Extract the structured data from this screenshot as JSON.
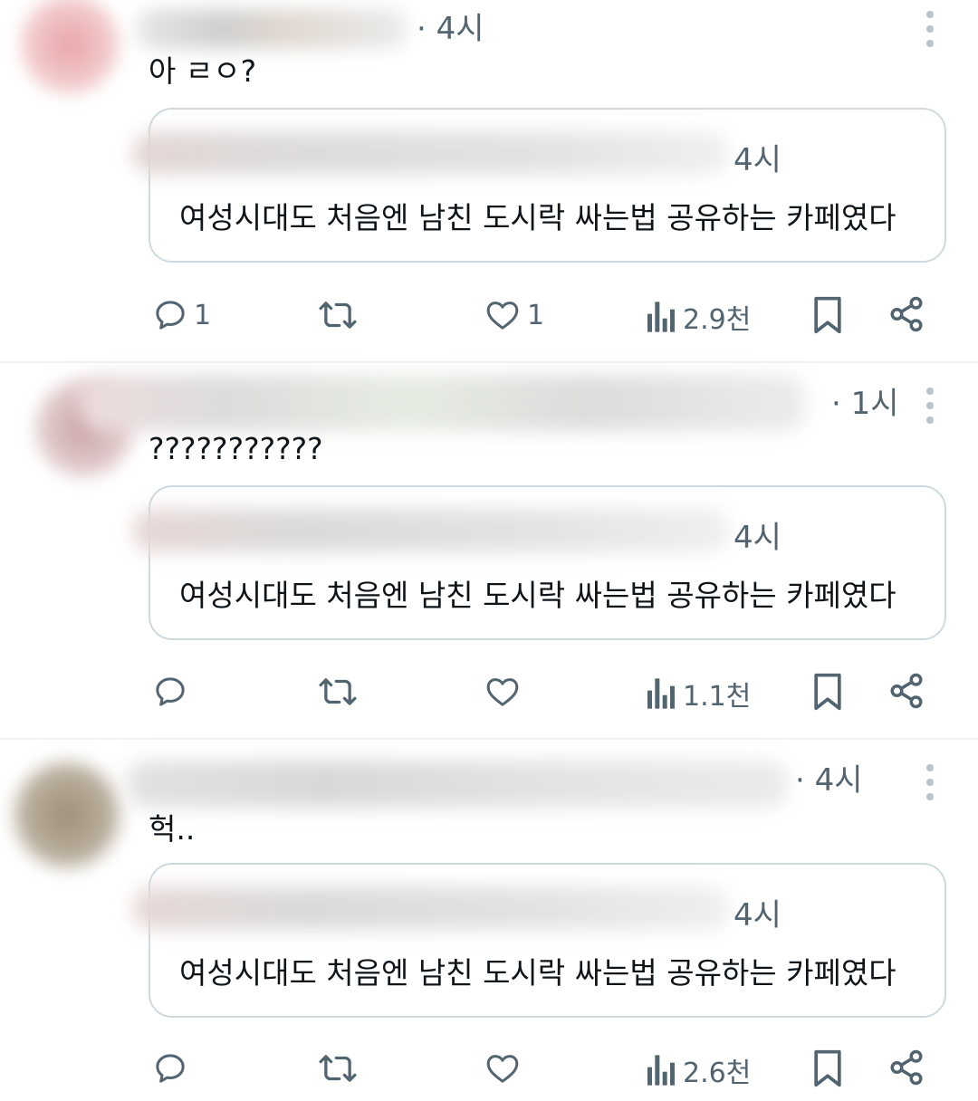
{
  "posts": [
    {
      "time": "· 4시",
      "text": "아 ㄹㅇ?",
      "quote": {
        "time": "4시",
        "text": "여성시대도 처음엔 남친 도시락 싸는법 공유하는 카페였다"
      },
      "actions": {
        "replies": "1",
        "retweets": "",
        "likes": "1",
        "views": "2.9천"
      }
    },
    {
      "time": "· 1시",
      "text": "???????????",
      "quote": {
        "time": "4시",
        "text": "여성시대도 처음엔 남친 도시락 싸는법 공유하는 카페였다"
      },
      "actions": {
        "replies": "",
        "retweets": "",
        "likes": "",
        "views": "1.1천"
      }
    },
    {
      "time": "· 4시",
      "text": "헉..",
      "quote": {
        "time": "4시",
        "text": "여성시대도 처음엔 남친 도시락 싸는법 공유하는 카페였다"
      },
      "actions": {
        "replies": "",
        "retweets": "",
        "likes": "",
        "views": "2.6천"
      }
    }
  ],
  "colors": {
    "text": "#0f1419",
    "muted": "#536471",
    "border": "#cfd9de",
    "divider": "#eff3f4"
  },
  "icons": [
    "reply-icon",
    "retweet-icon",
    "like-icon",
    "views-icon",
    "bookmark-icon",
    "share-icon",
    "more-icon"
  ]
}
